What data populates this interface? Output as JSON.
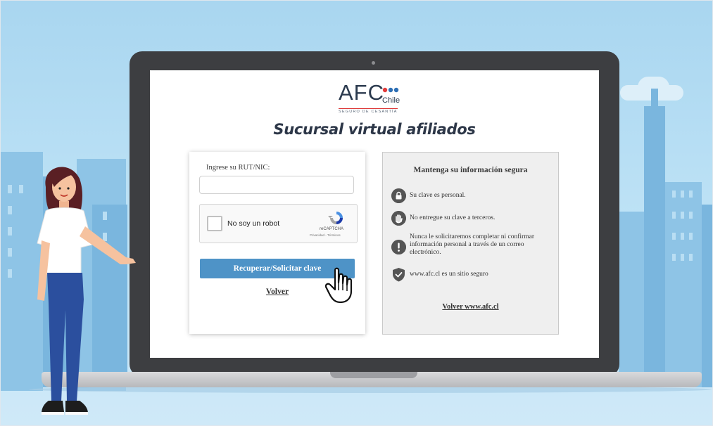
{
  "brand": {
    "logo_main": "AFC",
    "logo_country": "Chile",
    "logo_tagline": "SEGURO DE CESANTÍA"
  },
  "page": {
    "heading": "Sucursal virtual afiliados"
  },
  "login_form": {
    "rut_label": "Ingrese su RUT/NIC:",
    "rut_value": "",
    "captcha_label": "No soy un robot",
    "captcha_brand": "reCAPTCHA",
    "captcha_links": "Privacidad - Términos",
    "submit_label": "Recuperar/Solicitar clave",
    "back_label": "Volver"
  },
  "info_panel": {
    "title": "Mantenga su información segura",
    "items": [
      {
        "icon": "lock-icon",
        "text": "Su clave es personal."
      },
      {
        "icon": "hand-stop-icon",
        "text": "No entregue su clave a terceros."
      },
      {
        "icon": "exclamation-icon",
        "text": "Nunca le solicitaremos completar ni confirmar información personal a través de un correo electrónico."
      },
      {
        "icon": "shield-check-icon",
        "text": "www.afc.cl es un sitio seguro"
      }
    ],
    "back_link": "Volver www.afc.cl"
  },
  "colors": {
    "sky": "#a9d6f0",
    "button": "#4e93c7",
    "laptop_frame": "#3d3e41"
  }
}
